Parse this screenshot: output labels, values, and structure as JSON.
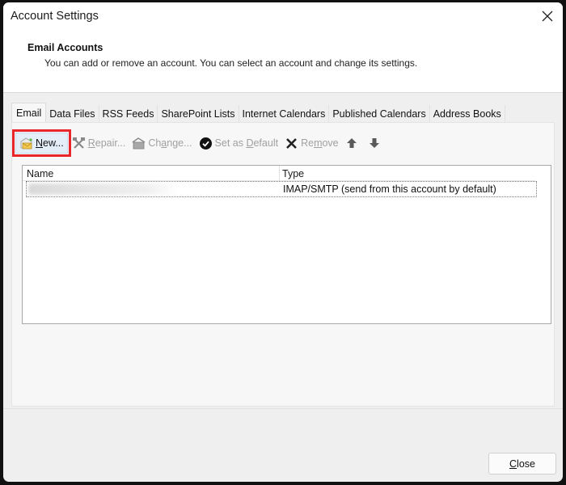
{
  "window": {
    "title": "Account Settings",
    "close_icon": "close-x-icon"
  },
  "header": {
    "section_title": "Email Accounts",
    "description": "You can add or remove an account. You can select an account and change its settings."
  },
  "tabs": [
    {
      "label": "Email",
      "active": true
    },
    {
      "label": "Data Files",
      "active": false
    },
    {
      "label": "RSS Feeds",
      "active": false
    },
    {
      "label": "SharePoint Lists",
      "active": false
    },
    {
      "label": "Internet Calendars",
      "active": false
    },
    {
      "label": "Published Calendars",
      "active": false
    },
    {
      "label": "Address Books",
      "active": false
    }
  ],
  "toolbar": {
    "new": {
      "label": "New...",
      "icon": "new-account-envelope-icon",
      "enabled": true,
      "highlighted": true
    },
    "repair": {
      "label": "Repair...",
      "icon": "repair-tools-icon",
      "enabled": false
    },
    "change": {
      "label": "Change...",
      "icon": "change-account-icon",
      "enabled": false
    },
    "set_default": {
      "label": "Set as Default",
      "icon": "checkmark-circle-icon",
      "enabled": false
    },
    "remove": {
      "label": "Remove",
      "icon": "remove-x-icon",
      "enabled": false
    },
    "move_up": {
      "icon": "arrow-up-icon"
    },
    "move_down": {
      "icon": "arrow-down-icon"
    }
  },
  "accounts_list": {
    "columns": [
      "Name",
      "Type"
    ],
    "rows": [
      {
        "name": "[blurred]",
        "type": "IMAP/SMTP (send from this account by default)"
      }
    ]
  },
  "footer": {
    "close_label": "Close"
  },
  "colors": {
    "highlight_box": "#e8262b",
    "window_bg": "#efefef",
    "header_bg": "#ffffff"
  }
}
